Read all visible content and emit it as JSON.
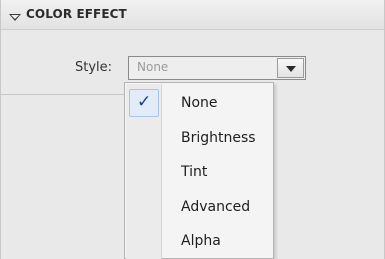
{
  "section": {
    "title": "COLOR EFFECT"
  },
  "style": {
    "label": "Style:",
    "value": "None",
    "options": [
      {
        "label": "None",
        "selected": true
      },
      {
        "label": "Brightness",
        "selected": false
      },
      {
        "label": "Tint",
        "selected": false
      },
      {
        "label": "Advanced",
        "selected": false
      },
      {
        "label": "Alpha",
        "selected": false
      }
    ]
  },
  "icons": {
    "collapse": "triangle-down-icon",
    "dropdown": "chevron-down-icon",
    "check": "checkmark-icon"
  },
  "colors": {
    "accent_check": "#1f3f8a",
    "selected_bg": "#e1ecf8"
  }
}
